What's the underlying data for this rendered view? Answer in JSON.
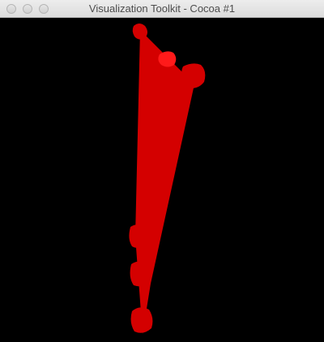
{
  "window": {
    "title": "Visualization Toolkit - Cocoa #1"
  },
  "scene": {
    "background_color": "#000000",
    "object_color": "#d40000",
    "highlight_color": "#ff1a1a"
  }
}
